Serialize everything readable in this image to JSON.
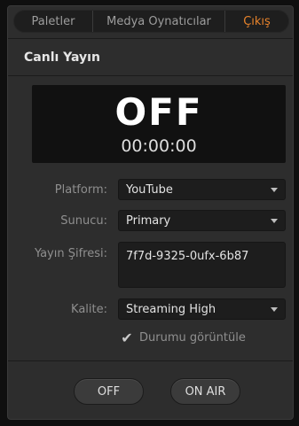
{
  "tabs": [
    "Paletler",
    "Medya Oynatıcılar",
    "Çıkış"
  ],
  "active_tab_color": "#e8832b",
  "section": {
    "title": "Canlı Yayın"
  },
  "status": {
    "state": "OFF",
    "time": "00:00:00"
  },
  "form": {
    "platform_label": "Platform:",
    "platform_value": "YouTube",
    "server_label": "Sunucu:",
    "server_value": "Primary",
    "key_label": "Yayın Şifresi:",
    "key_value": "7f7d-9325-0ufx-6b87",
    "quality_label": "Kalite:",
    "quality_value": "Streaming High",
    "show_status_label": "Durumu görüntüle",
    "show_status_checked": true
  },
  "buttons": {
    "off": "OFF",
    "on_air": "ON AIR"
  }
}
